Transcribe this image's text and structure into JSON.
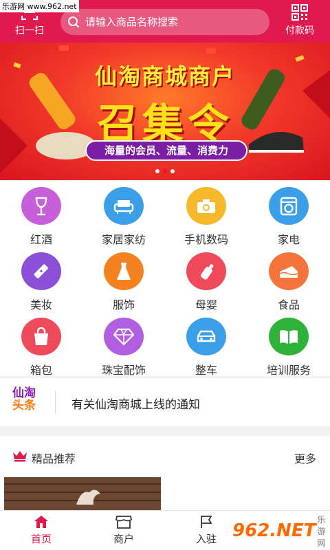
{
  "watermark_top": "乐游网 www.962.net",
  "header": {
    "scan_label": "扫一扫",
    "search_placeholder": "请输入商品名称搜索",
    "pay_code_label": "付款码"
  },
  "banner": {
    "title": "仙淘商城商户",
    "headline": "召集令",
    "subtitle": "海量的会员、流量、消费力",
    "dots": 3,
    "active_dot": 1
  },
  "categories": [
    {
      "label": "红酒",
      "icon": "wine-glass-icon",
      "color": "#c65fd9"
    },
    {
      "label": "家居家纺",
      "icon": "sofa-icon",
      "color": "#3a9fe8"
    },
    {
      "label": "手机数码",
      "icon": "camera-icon",
      "color": "#f6b92b"
    },
    {
      "label": "家电",
      "icon": "washing-machine-icon",
      "color": "#3a9fe8"
    },
    {
      "label": "美妆",
      "icon": "lipstick-icon",
      "color": "#8c4fd8"
    },
    {
      "label": "服饰",
      "icon": "dress-icon",
      "color": "#f58220"
    },
    {
      "label": "母婴",
      "icon": "baby-bottle-icon",
      "color": "#ef4a59"
    },
    {
      "label": "食品",
      "icon": "cake-icon",
      "color": "#f5743c"
    },
    {
      "label": "箱包",
      "icon": "bag-icon",
      "color": "#ef4a59"
    },
    {
      "label": "珠宝配饰",
      "icon": "diamond-icon",
      "color": "#b05fe0"
    },
    {
      "label": "整车",
      "icon": "car-icon",
      "color": "#3a9fe8"
    },
    {
      "label": "培训服务",
      "icon": "book-icon",
      "color": "#2fb23a"
    }
  ],
  "notice": {
    "logo_line1": "仙淘",
    "logo_line2": "头条",
    "text": "有关仙淘商城上线的通知"
  },
  "featured": {
    "title": "精品推荐",
    "more": "更多"
  },
  "tabs": [
    {
      "label": "首页",
      "icon": "home-icon",
      "active": true
    },
    {
      "label": "商户",
      "icon": "store-icon",
      "active": false
    },
    {
      "label": "入驻",
      "icon": "flag-icon",
      "active": false
    }
  ],
  "watermark_bottom": {
    "mark": "962.NET",
    "text": "乐游网"
  },
  "colors": {
    "brand": "#e01a4f",
    "banner_accent": "#ffe21a"
  }
}
